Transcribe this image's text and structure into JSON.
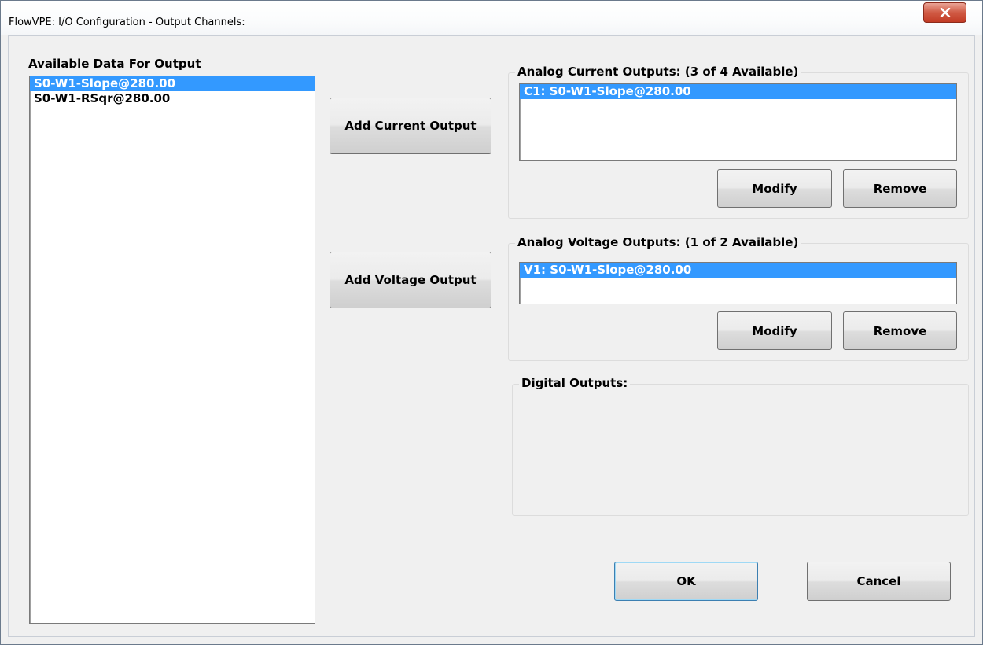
{
  "window": {
    "title": "FlowVPE: I/O Configuration - Output Channels:",
    "close_icon": "close-icon"
  },
  "available": {
    "label": "Available Data For Output",
    "items": [
      "S0-W1-Slope@280.00",
      "S0-W1-RSqr@280.00"
    ],
    "selected_index": 0
  },
  "buttons": {
    "add_current": "Add Current Output",
    "add_voltage": "Add Voltage Output",
    "ok": "OK",
    "cancel": "Cancel"
  },
  "current_outputs": {
    "title": "Analog Current Outputs:  (3 of 4 Available)",
    "items": [
      "C1: S0-W1-Slope@280.00"
    ],
    "modify_label": "Modify",
    "remove_label": "Remove"
  },
  "voltage_outputs": {
    "title": "Analog Voltage Outputs:  (1 of 2 Available)",
    "items": [
      "V1: S0-W1-Slope@280.00"
    ],
    "modify_label": "Modify",
    "remove_label": "Remove"
  },
  "digital_outputs": {
    "title": "Digital Outputs:"
  },
  "colors": {
    "selection": "#3399ff",
    "close_button": "#c23b25",
    "dialog_background": "#f0f0f0"
  }
}
